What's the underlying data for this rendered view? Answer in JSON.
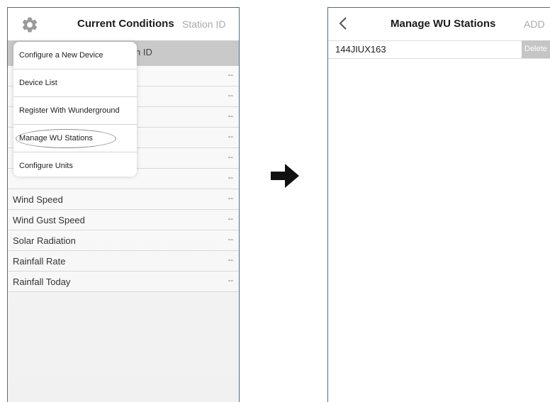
{
  "left": {
    "header": {
      "title": "Current Conditions",
      "station_link": "Station ID"
    },
    "subheader_text": "n ID",
    "rows": [
      {
        "label": "",
        "value": "--"
      },
      {
        "label": "",
        "value": "--"
      },
      {
        "label": "",
        "value": "--"
      },
      {
        "label": "",
        "value": "--"
      },
      {
        "label": "",
        "value": "--"
      },
      {
        "label": "",
        "value": "--"
      },
      {
        "label": "Wind Speed",
        "value": "--"
      },
      {
        "label": "Wind Gust Speed",
        "value": "--"
      },
      {
        "label": "Solar Radiation",
        "value": "--"
      },
      {
        "label": "Rainfall Rate",
        "value": "--"
      },
      {
        "label": "Rainfall Today",
        "value": "--"
      }
    ],
    "menu": [
      "Configure a New Device",
      "Device List",
      "Register With Wunderground",
      "Manage WU Stations",
      "Configure Units"
    ],
    "highlighted_menu_item": "Manage WU Stations"
  },
  "arrow_icon": "right-arrow-icon",
  "right": {
    "header": {
      "title": "Manage WU Stations",
      "add_label": "ADD"
    },
    "stations": [
      {
        "id": "144JIUX163",
        "delete_label": "Delete"
      }
    ]
  },
  "colors": {
    "frame_border": "#3f6f9e",
    "subheader_bg": "#c9c9c9",
    "delete_bg": "#c5c5c5"
  }
}
